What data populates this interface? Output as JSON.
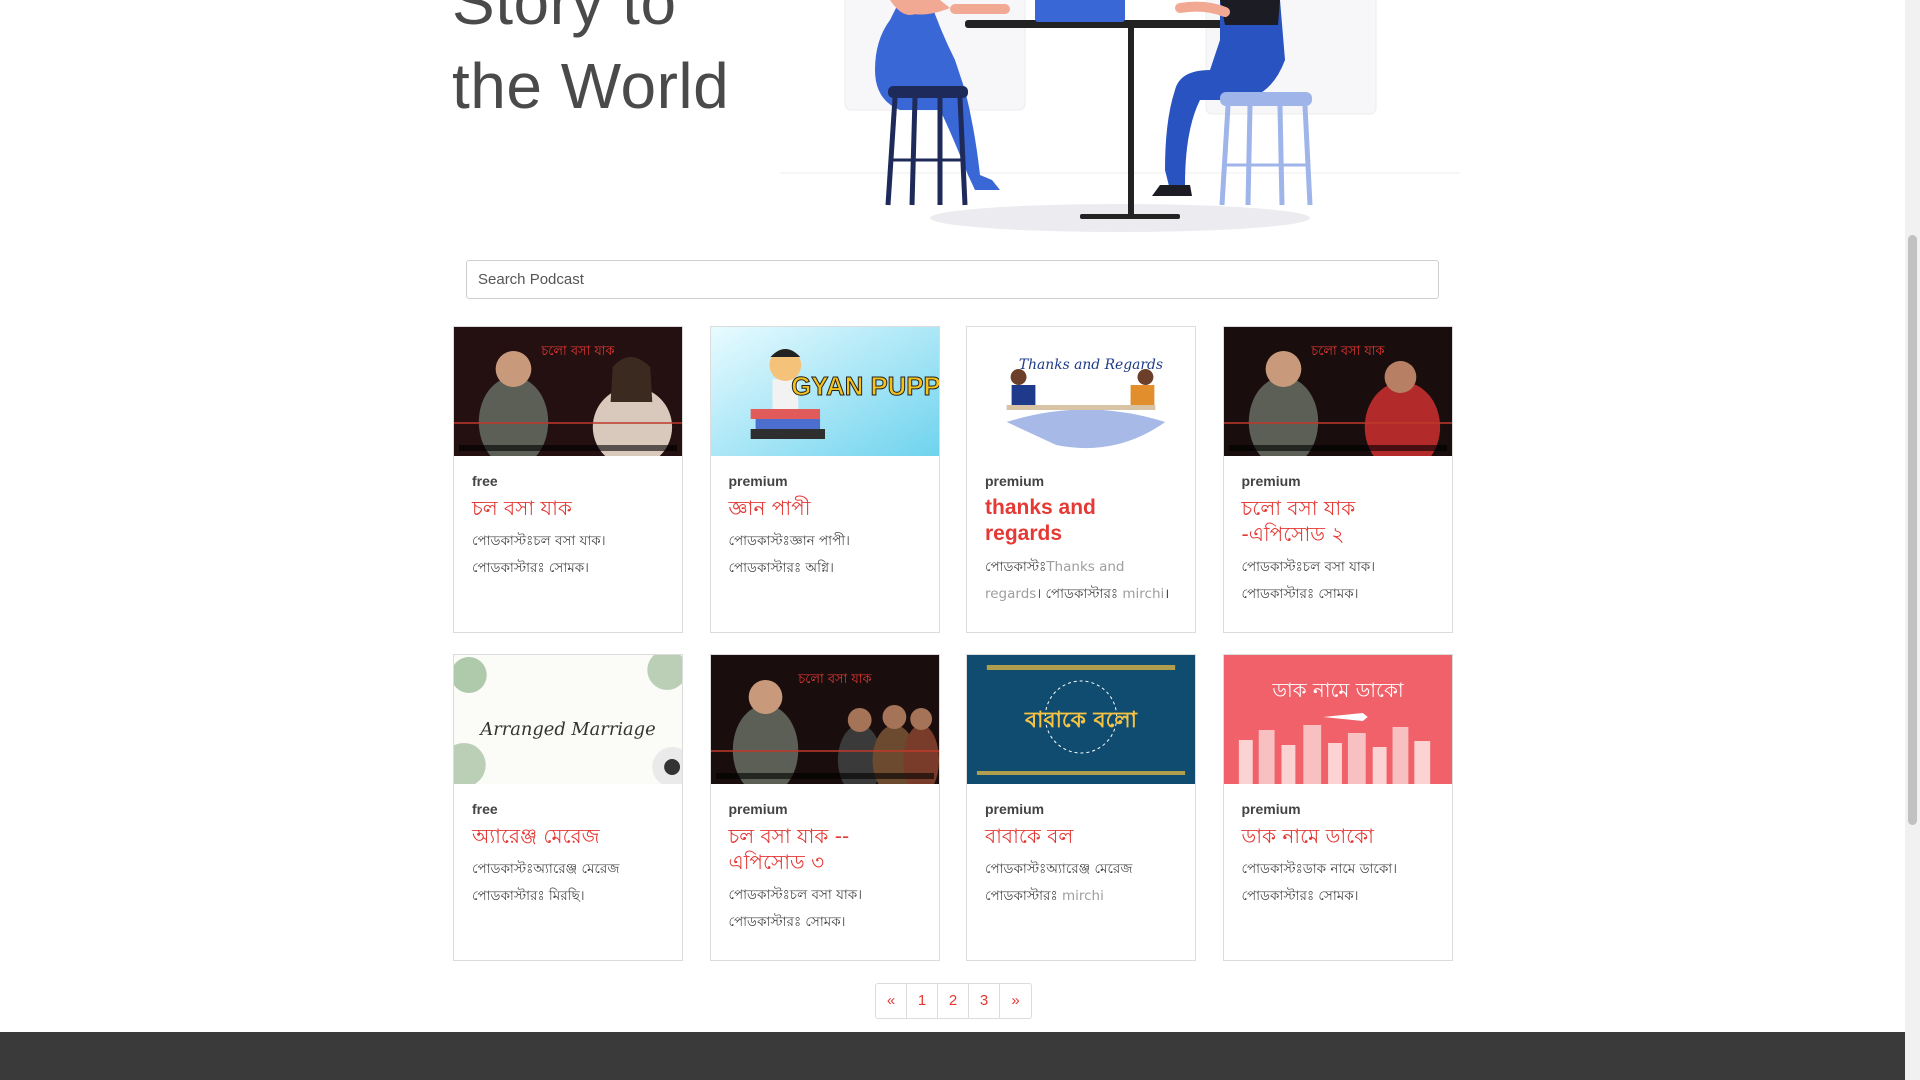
{
  "hero": {
    "title_line1": "Story to",
    "title_line2": "the World"
  },
  "search": {
    "placeholder": "Search Podcast"
  },
  "cards": [
    {
      "tier": "free",
      "title": "চল বসা যাক",
      "desc": "পোডকাস্টঃচল বসা যাক। পোডকাস্টারঃ সোমক।"
    },
    {
      "tier": "premium",
      "title": "জ্ঞান পাপী",
      "desc": "পোডকাস্টঃজ্ঞান পাপী। পোডকাস্টারঃ অগ্নি।"
    },
    {
      "tier": "premium",
      "title": "thanks and regards",
      "desc_prefix": "পোডকাস্টঃ",
      "desc_muted1": "Thanks and regards",
      "desc_mid": "। পোডকাস্টারঃ ",
      "desc_muted2": "mirchi",
      "desc_suffix": "।"
    },
    {
      "tier": "premium",
      "title": "চলো বসা যাক -এপিসোড ২",
      "desc": "পোডকাস্টঃচল বসা যাক। পোডকাস্টারঃ সোমক।"
    },
    {
      "tier": "free",
      "title": "অ্যারেঞ্জ মেরেজ",
      "desc": "পোডকাস্টঃঅ্যারেঞ্জ মেরেজ পোডকাস্টারঃ মিরছি।"
    },
    {
      "tier": "premium",
      "title": "চল বসা যাক --এপিসোড ৩",
      "desc": "পোডকাস্টঃচল বসা যাক। পোডকাস্টারঃ সোমক।"
    },
    {
      "tier": "premium",
      "title": "বাবাকে বল",
      "desc_prefix": "পোডকাস্টঃঅ্যারেঞ্জ মেরেজ পোডকাস্টারঃ ",
      "desc_muted1": "mirchi"
    },
    {
      "tier": "premium",
      "title": "ডাক নামে ডাকো",
      "desc": "পোডকাস্টঃডাক নামে ডাকো। পোডকাস্টারঃ সোমক।"
    }
  ],
  "thumbs": {
    "c1_text": "চলো বসা যাক",
    "c2_text": "GYAN PUPPY",
    "c3_text": "Thanks and Regards",
    "c5_text": "Arranged Marriage",
    "c7_text": "বাবাকে বলো",
    "c8_text": "ডাক নামে ডাকো"
  },
  "pagination": {
    "prev": "«",
    "pages": [
      "1",
      "2",
      "3"
    ],
    "next": "»"
  },
  "colors": {
    "accent": "#e53935",
    "footer": "#3a3a3a"
  }
}
